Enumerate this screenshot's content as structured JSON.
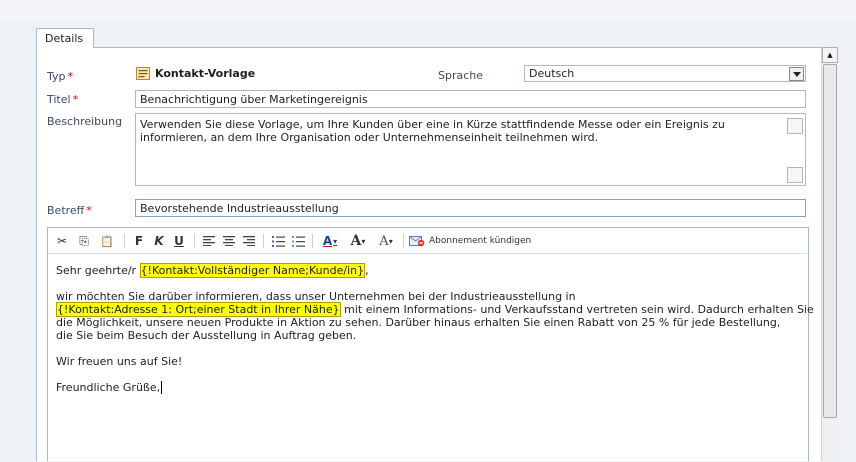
{
  "tab": {
    "details": "Details"
  },
  "form": {
    "typ_label": "Typ",
    "typ_value": "Kontakt-Vorlage",
    "sprache_label": "Sprache",
    "sprache_value": "Deutsch",
    "titel_label": "Titel",
    "titel_value": "Benachrichtigung über Marketingereignis",
    "beschreibung_label": "Beschreibung",
    "beschreibung_value": "Verwenden Sie diese Vorlage, um Ihre Kunden über eine in Kürze stattfindende Messe oder ein Ereignis zu informieren, an dem Ihre Organisation oder Unternehmenseinheit teilnehmen wird.",
    "betreff_label": "Betreff",
    "betreff_value": "Bevorstehende Industrieausstellung",
    "required_mark": "*"
  },
  "toolbar": {
    "cut": "✂",
    "copy": "⎘",
    "paste": "📋",
    "bold": "F",
    "italic": "K",
    "underline": "U",
    "font_color": "A",
    "font_size": "A",
    "font_face": "A",
    "dropdown_arrow": "▾",
    "unsubscribe_label": "Abonnement kündigen"
  },
  "body": {
    "salutation_pre": "Sehr geehrte/r ",
    "salutation_field": "{!Kontakt:Vollständiger Name;Kunde/in}",
    "salutation_post": ",",
    "para1_line1": "wir möchten Sie darüber informieren, dass unser Unternehmen bei der Industrieausstellung in",
    "para1_field": "{!Kontakt:Adresse 1: Ort;einer Stadt in Ihrer Nähe}",
    "para1_line2_rest": " mit einem Informations- und Verkaufsstand vertreten sein wird. Dadurch erhalten Sie",
    "para1_line3": "die Möglichkeit, unsere neuen Produkte in Aktion zu sehen. Darüber hinaus erhalten Sie einen Rabatt von 25 % für jede Bestellung,",
    "para1_line4": "die Sie beim Besuch der Ausstellung in Auftrag geben.",
    "closing1": "Wir freuen uns auf Sie!",
    "closing2": "Freundliche Grüße,"
  },
  "scrollbar": {
    "up_arrow": "▲"
  },
  "colors": {
    "highlight": "#ffff00",
    "required": "#d20000",
    "border": "#a8b7cb"
  }
}
